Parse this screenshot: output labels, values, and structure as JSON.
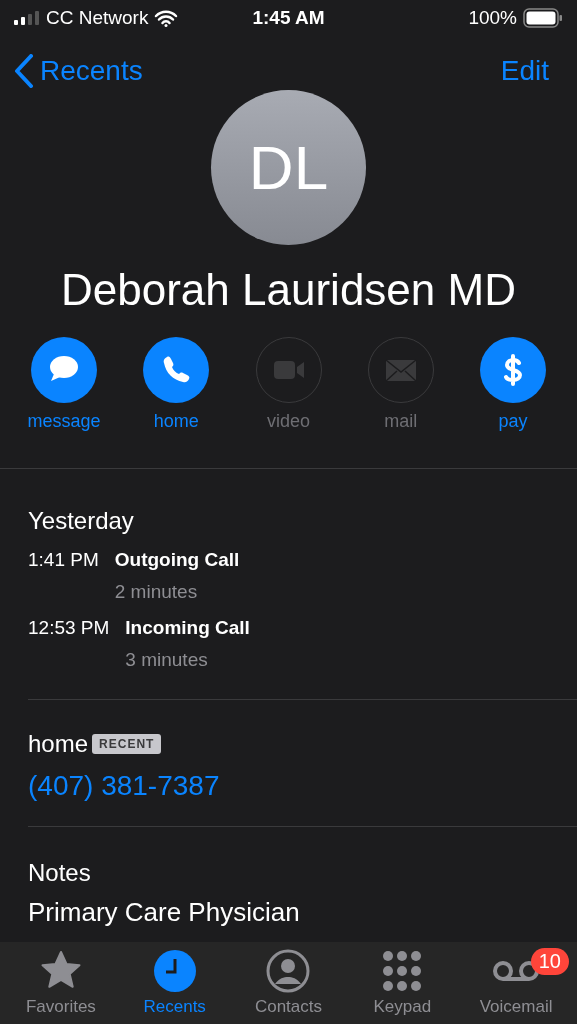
{
  "status_bar": {
    "carrier": "CC Network",
    "time": "1:45 AM",
    "battery": "100%"
  },
  "nav": {
    "back": "Recents",
    "action": "Edit"
  },
  "contact": {
    "initials": "DL",
    "name": "Deborah Lauridsen MD"
  },
  "actions": [
    {
      "kind": "message",
      "label": "message",
      "enabled": true
    },
    {
      "kind": "phone",
      "label": "home",
      "enabled": true
    },
    {
      "kind": "video",
      "label": "video",
      "enabled": false
    },
    {
      "kind": "mail",
      "label": "mail",
      "enabled": false
    },
    {
      "kind": "pay",
      "label": "pay",
      "enabled": true
    }
  ],
  "calls": {
    "heading": "Yesterday",
    "items": [
      {
        "time": "1:41 PM",
        "type": "Outgoing Call",
        "duration": "2 minutes"
      },
      {
        "time": "12:53 PM",
        "type": "Incoming Call",
        "duration": "3 minutes"
      }
    ]
  },
  "phone": {
    "label": "home",
    "badge": "RECENT",
    "number": "(407) 381-7387"
  },
  "notes": {
    "label": "Notes",
    "text": "Primary Care Physician"
  },
  "tabs": [
    {
      "kind": "favorites",
      "label": "Favorites",
      "selected": false
    },
    {
      "kind": "recents",
      "label": "Recents",
      "selected": true
    },
    {
      "kind": "contacts",
      "label": "Contacts",
      "selected": false
    },
    {
      "kind": "keypad",
      "label": "Keypad",
      "selected": false
    },
    {
      "kind": "voicemail",
      "label": "Voicemail",
      "selected": false,
      "badge": "10"
    }
  ]
}
